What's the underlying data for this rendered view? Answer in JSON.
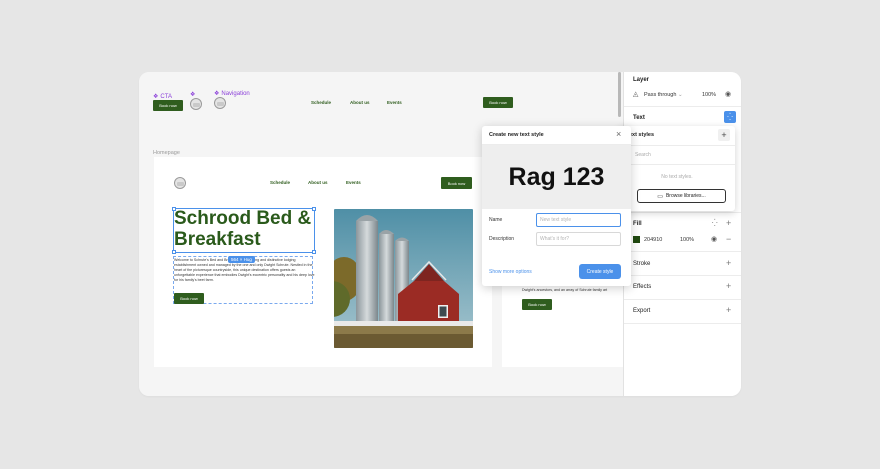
{
  "canvas": {
    "top_components": {
      "cta_label": "CTA",
      "cta_button": "Book now",
      "nav_label": "Navigation",
      "nav_links": [
        "Schedule",
        "About us",
        "Events"
      ],
      "nav_button": "Book now"
    },
    "frame_label": "Homepage",
    "homepage": {
      "nav_links": [
        "Schedule",
        "About us",
        "Events"
      ],
      "nav_button": "Book now",
      "hero_title": "Schrood Bed & Breakfast",
      "hug_badge": "564 × Hug",
      "body_text": "Welcome to Schrute's Bed and Breakfast, a charming and distinctive lodging establishment owned and managed by the one and only Dwight Schrute. Nestled in the heart of the picturesque countryside, this unique destination offers guests an unforgettable experience that embodies Dwight's eccentric personality and his deep love for his family's beet farm.",
      "book_button": "Book now"
    },
    "second_frame": {
      "body_text": "Dwight's ancestors, and an array of Schrute family art",
      "book_button": "Book now"
    }
  },
  "right_panel": {
    "layer_title": "Layer",
    "blend_mode": "Pass through",
    "opacity": "100%",
    "text_title": "Text",
    "fill_title": "Fill",
    "fill_hex": "204910",
    "fill_opacity": "100%",
    "fill_color": "#204910",
    "stroke_title": "Stroke",
    "effects_title": "Effects",
    "export_title": "Export"
  },
  "text_styles_popover": {
    "title": "Text styles",
    "search_placeholder": "Search",
    "empty_text": "No text styles.",
    "browse_button": "Browse libraries..."
  },
  "dialog": {
    "title": "Create new text style",
    "preview_text": "Rag 123",
    "name_label": "Name",
    "name_placeholder": "New text style",
    "description_label": "Description",
    "description_placeholder": "What's it for?",
    "more_options": "Show more options",
    "create_button": "Create style"
  },
  "colors": {
    "brand_green": "#2f5d1e",
    "accent_blue": "#4b91ea",
    "component_purple": "#8b3fd9"
  }
}
